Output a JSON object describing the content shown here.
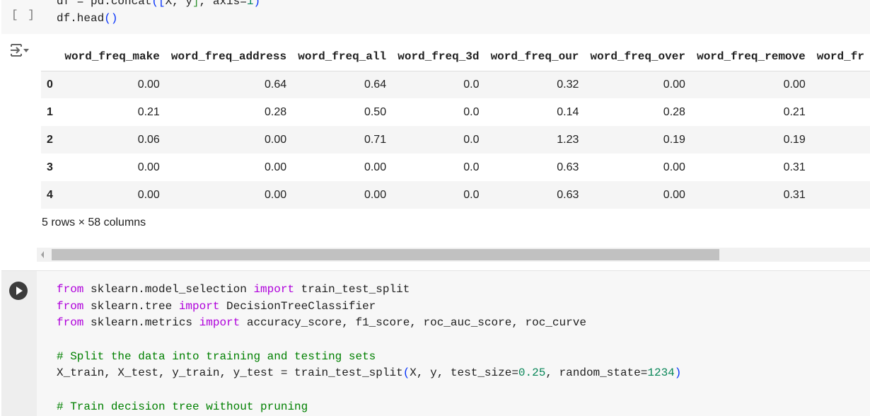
{
  "cell1": {
    "exec_count": "[ ]",
    "code_line1": {
      "a": "df = pd.concat",
      "b": "([",
      "c": "X, y",
      "d": "]",
      "e": ", axis=",
      "f": "1",
      "g": ")"
    },
    "code_line2": {
      "a": "df.head",
      "b": "()"
    }
  },
  "output": {
    "columns": [
      "",
      "word_freq_make",
      "word_freq_address",
      "word_freq_all",
      "word_freq_3d",
      "word_freq_our",
      "word_freq_over",
      "word_freq_remove",
      "word_fr"
    ],
    "rows": [
      [
        "0",
        "0.00",
        "0.64",
        "0.64",
        "0.0",
        "0.32",
        "0.00",
        "0.00"
      ],
      [
        "1",
        "0.21",
        "0.28",
        "0.50",
        "0.0",
        "0.14",
        "0.28",
        "0.21"
      ],
      [
        "2",
        "0.06",
        "0.00",
        "0.71",
        "0.0",
        "1.23",
        "0.19",
        "0.19"
      ],
      [
        "3",
        "0.00",
        "0.00",
        "0.00",
        "0.0",
        "0.63",
        "0.00",
        "0.31"
      ],
      [
        "4",
        "0.00",
        "0.00",
        "0.00",
        "0.0",
        "0.63",
        "0.00",
        "0.31"
      ]
    ],
    "shape": "5 rows × 58 columns",
    "scroll_fraction": 0.8
  },
  "cell2": {
    "lines": [
      [
        {
          "t": "from",
          "c": "kw"
        },
        {
          "t": " sklearn.model_selection "
        },
        {
          "t": "import",
          "c": "kw"
        },
        {
          "t": " train_test_split"
        }
      ],
      [
        {
          "t": "from",
          "c": "kw"
        },
        {
          "t": " sklearn.tree "
        },
        {
          "t": "import",
          "c": "kw"
        },
        {
          "t": " DecisionTreeClassifier"
        }
      ],
      [
        {
          "t": "from",
          "c": "kw"
        },
        {
          "t": " sklearn.metrics "
        },
        {
          "t": "import",
          "c": "kw"
        },
        {
          "t": " accuracy_score, f1_score, roc_auc_score, roc_curve"
        }
      ],
      [],
      [
        {
          "t": "# Split the data into training and testing sets",
          "c": "cm"
        }
      ],
      [
        {
          "t": "X_train, X_test, y_train, y_test = train_test_split"
        },
        {
          "t": "(",
          "c": "br"
        },
        {
          "t": "X, y, test_size="
        },
        {
          "t": "0.25",
          "c": "num"
        },
        {
          "t": ", random_state="
        },
        {
          "t": "1234",
          "c": "num"
        },
        {
          "t": ")",
          "c": "br"
        }
      ],
      [],
      [
        {
          "t": "# Train decision tree without pruning",
          "c": "cm"
        }
      ]
    ]
  },
  "colors": {
    "keyword": "#af00db",
    "comment": "#008000",
    "number": "#098658",
    "bracket": "#0431fa"
  }
}
